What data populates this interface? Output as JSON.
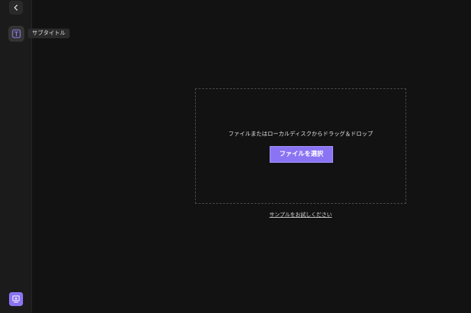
{
  "sidebar": {
    "back_icon": "chevron-left-icon",
    "tool_icon": "text-box-icon",
    "tool_tooltip": "サブタイトル",
    "bottom_icon": "monitor-download-icon"
  },
  "dropzone": {
    "instruction": "ファイルまたはローカルディスクからドラッグ＆ドロップ",
    "select_label": "ファイルを選択"
  },
  "sample_link": "サンプルをお試しください",
  "colors": {
    "accent": "#8b74f4",
    "background": "#121212",
    "sidebar": "#1b1b1b"
  }
}
